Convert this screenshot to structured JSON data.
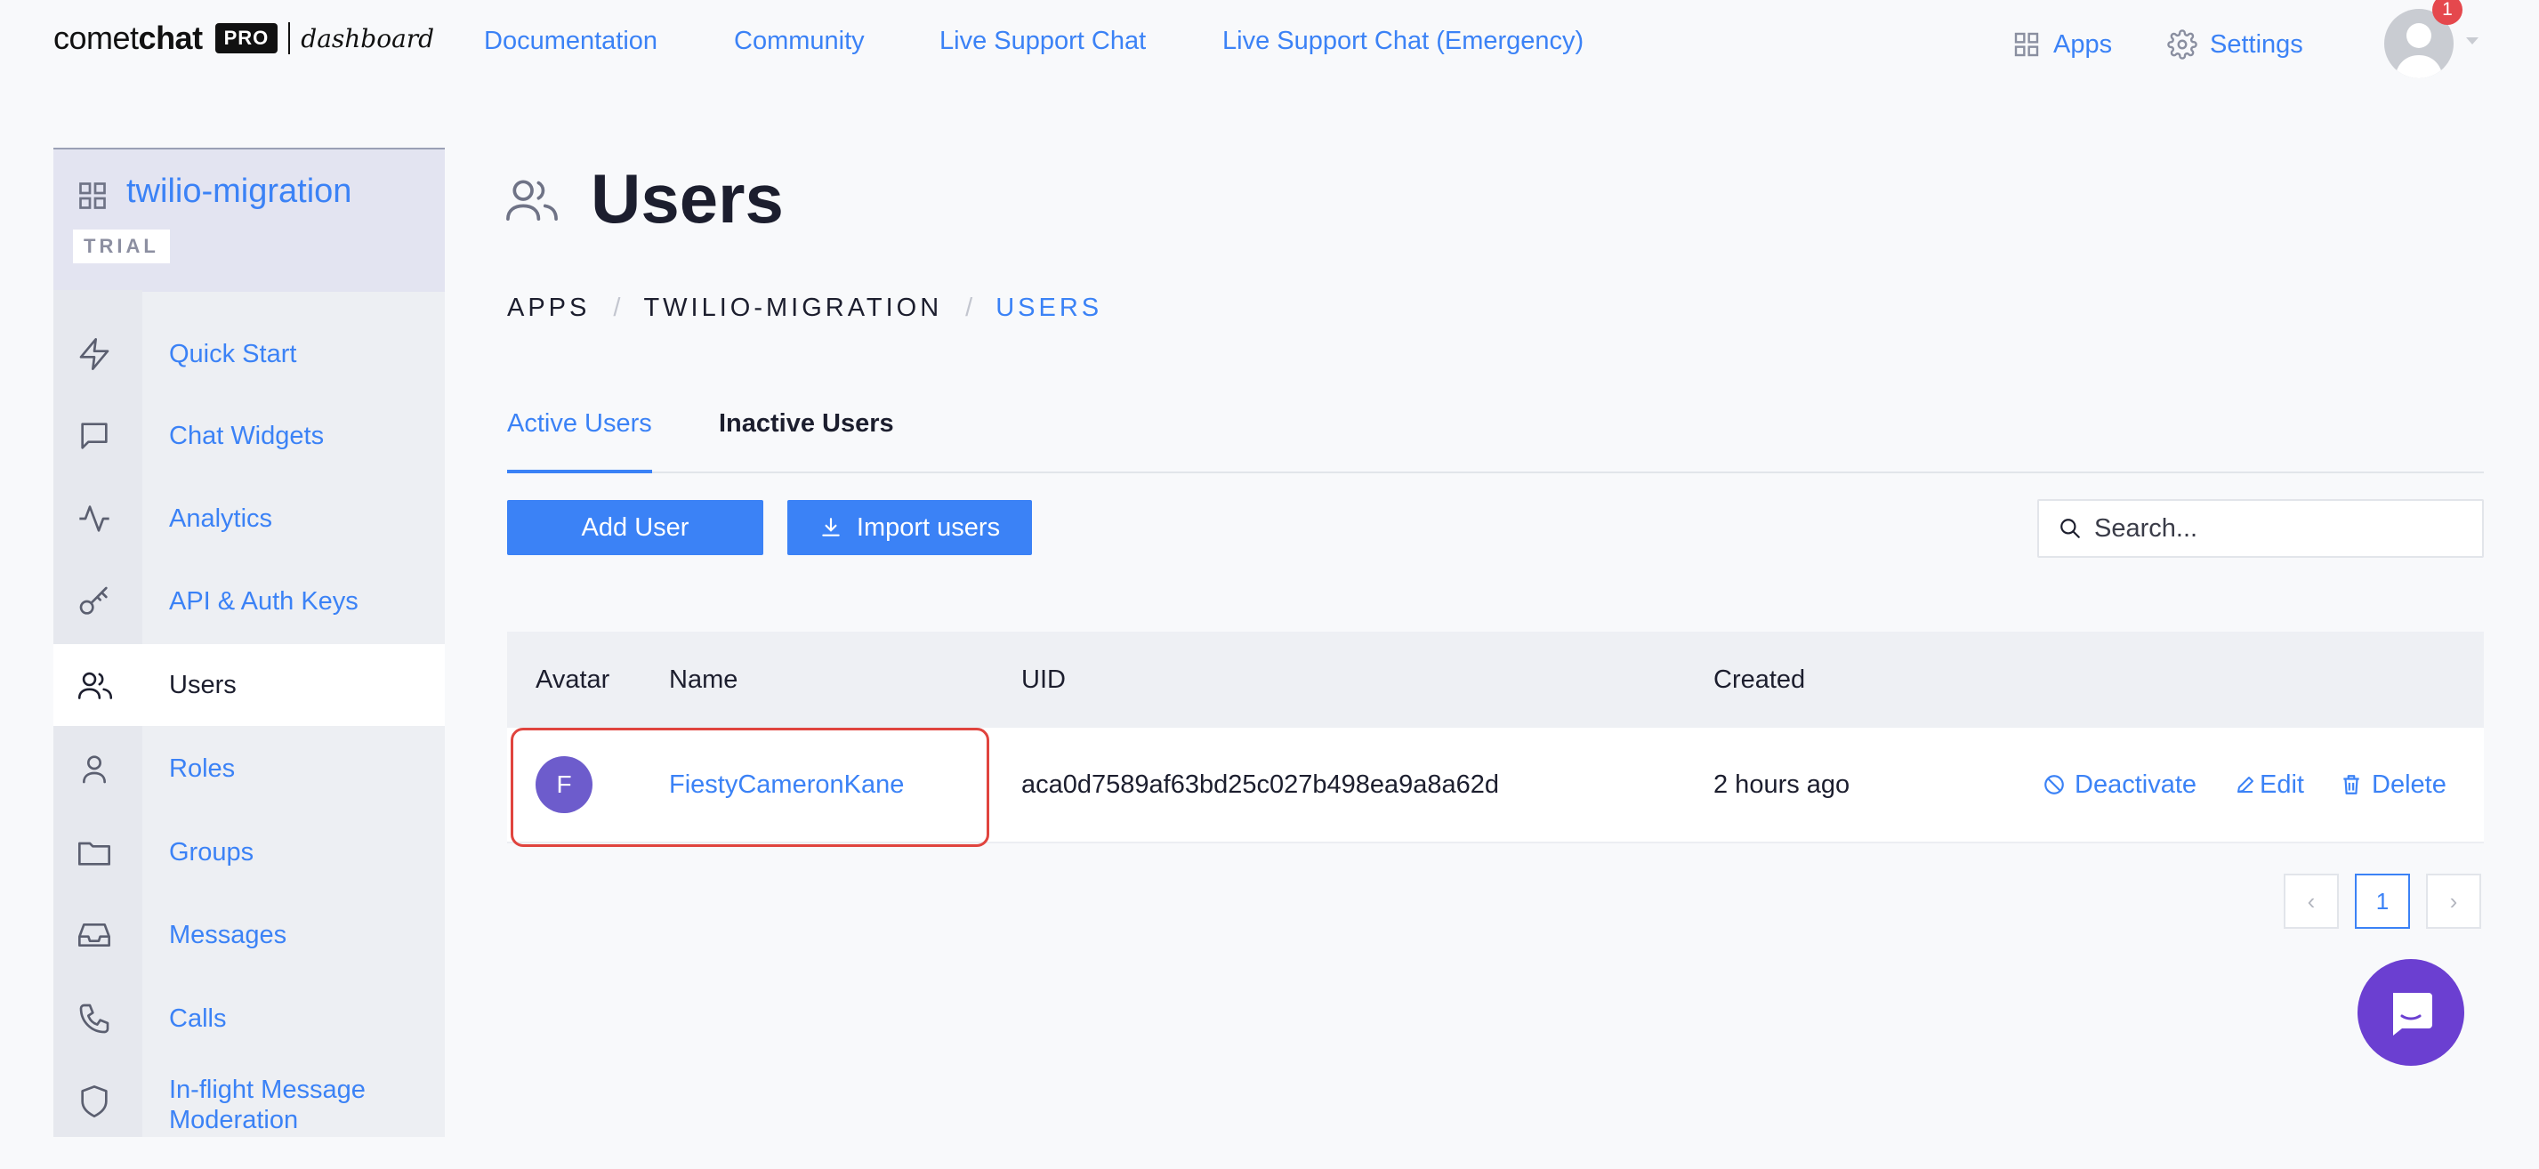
{
  "header": {
    "logo_word_light": "comet",
    "logo_word_bold": "chat",
    "logo_badge": "PRO",
    "logo_suffix": "dashboard",
    "nav": [
      {
        "label": "Documentation"
      },
      {
        "label": "Community"
      },
      {
        "label": "Live Support Chat"
      },
      {
        "label": "Live Support Chat (Emergency)"
      }
    ],
    "apps_label": "Apps",
    "settings_label": "Settings",
    "notification_count": "1"
  },
  "sidebar": {
    "app_name": "twilio-migration",
    "plan_badge": "TRIAL",
    "items": [
      {
        "label": "Quick Start",
        "icon": "bolt-icon"
      },
      {
        "label": "Chat Widgets",
        "icon": "chat-bubble-icon"
      },
      {
        "label": "Analytics",
        "icon": "activity-icon"
      },
      {
        "label": "API & Auth Keys",
        "icon": "key-icon"
      },
      {
        "label": "Users",
        "icon": "users-icon",
        "active": true
      },
      {
        "label": "Roles",
        "icon": "user-icon"
      },
      {
        "label": "Groups",
        "icon": "folder-icon"
      },
      {
        "label": "Messages",
        "icon": "inbox-icon"
      },
      {
        "label": "Calls",
        "icon": "phone-icon"
      },
      {
        "label": "In-flight Message Moderation",
        "icon": "shield-icon"
      }
    ]
  },
  "main": {
    "title": "Users",
    "breadcrumb": [
      "APPS",
      "TWILIO-MIGRATION",
      "USERS"
    ],
    "breadcrumb_sep": "/",
    "tabs": [
      {
        "label": "Active Users",
        "active": true
      },
      {
        "label": "Inactive Users",
        "active": false
      }
    ],
    "add_user_label": "Add User",
    "import_users_label": "Import users",
    "search": {
      "placeholder": "Search...",
      "value": ""
    },
    "table": {
      "columns": [
        "Avatar",
        "Name",
        "UID",
        "Created"
      ],
      "rows": [
        {
          "avatar_initial": "F",
          "name": "FiestyCameronKane",
          "uid": "aca0d7589af63bd25c027b498ea9a8a62d",
          "created": "2 hours ago",
          "actions": [
            "Deactivate",
            "Edit",
            "Delete"
          ]
        }
      ]
    },
    "pagination": {
      "prev": "‹",
      "current": "1",
      "next": "›"
    }
  },
  "colors": {
    "accent": "#3b82f6",
    "avatar": "#6d5ccc",
    "chat_launcher": "#6b3fd1",
    "highlight": "#e0443e"
  }
}
